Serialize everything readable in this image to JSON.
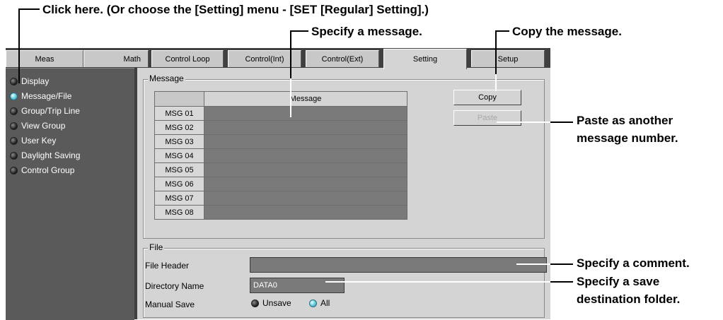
{
  "callouts": {
    "click_here": "Click here. (Or choose the [Setting] menu - [SET [Regular] Setting].)",
    "specify_message": "Specify a message.",
    "copy_message": "Copy the message.",
    "paste_line1": "Paste as another",
    "paste_line2": "message number.",
    "specify_comment": "Specify a comment.",
    "save_line1": "Specify a save",
    "save_line2": "destination folder."
  },
  "tabs": [
    {
      "label": "Meas"
    },
    {
      "label": "Math"
    },
    {
      "label": "Control Loop"
    },
    {
      "label": "Control(Int)"
    },
    {
      "label": "Control(Ext)"
    },
    {
      "label": "Setting",
      "active": true
    },
    {
      "label": "Setup"
    }
  ],
  "sidebar": {
    "items": [
      {
        "label": "Display"
      },
      {
        "label": "Message/File",
        "selected": true
      },
      {
        "label": "Group/Trip Line"
      },
      {
        "label": "View Group"
      },
      {
        "label": "User Key"
      },
      {
        "label": "Daylight Saving"
      },
      {
        "label": "Control Group"
      }
    ]
  },
  "message_group": {
    "title": "Message",
    "column_header": "Message",
    "rows": [
      {
        "label": "MSG 01",
        "value": ""
      },
      {
        "label": "MSG 02",
        "value": ""
      },
      {
        "label": "MSG 03",
        "value": ""
      },
      {
        "label": "MSG 04",
        "value": ""
      },
      {
        "label": "MSG 05",
        "value": ""
      },
      {
        "label": "MSG 06",
        "value": ""
      },
      {
        "label": "MSG 07",
        "value": ""
      },
      {
        "label": "MSG 08",
        "value": ""
      }
    ],
    "copy_label": "Copy",
    "paste_label": "Paste"
  },
  "file_group": {
    "title": "File",
    "file_header_label": "File Header",
    "file_header_value": "",
    "directory_label": "Directory Name",
    "directory_value": "DATA0",
    "manual_save_label": "Manual Save",
    "options": {
      "unsave": "Unsave",
      "all": "All"
    },
    "selected": "all"
  },
  "colors": {
    "led_on": "#5fc8d8",
    "field_bg": "#7a7a7a",
    "panel_bg": "#d4d4d4",
    "sidebar_bg": "#5a5a5a"
  }
}
